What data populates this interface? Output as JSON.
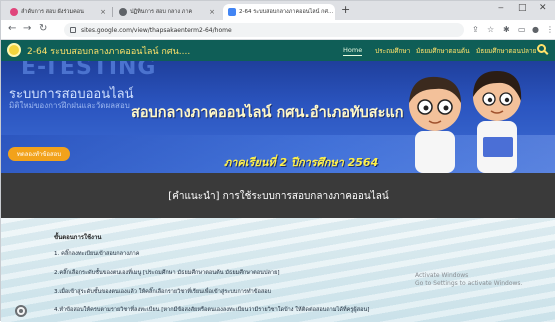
{
  "browser": {
    "tabs": [
      {
        "label": "ลำดับการ สอบ ผังร่วมคอน",
        "color": "#e0457b"
      },
      {
        "label": "ปฏิทินการ สอบ กลาง ภาค",
        "color": "#5f6368"
      },
      {
        "label": "2-64 ระบบสอบกลางภาคออนไลน์ กศ...",
        "color": "#4285f4"
      }
    ],
    "url": "sites.google.com/view/thapsakaenterm2-64/home",
    "window_controls": [
      "‒",
      "□",
      "✕"
    ]
  },
  "site": {
    "title": "2-64 ระบบสอบกลางภาคออนไลน์ กศน....",
    "nav": [
      "Home",
      "ประถมศึกษา",
      "มัธยมศึกษาตอนต้น",
      "มัธยมศึกษาตอนปลาย"
    ],
    "accent": "#0f5e57",
    "nav_color": "#ffe26a"
  },
  "hero": {
    "watermark": "E-TESTING",
    "bg_title": "ระบบการสอบออนไลน์",
    "bg_subtitle": "มิติใหม่ของการฝึกฝนและวัดผลสอบ",
    "line1": "สอบกลางภาคออนไลน์ กศน.อำเภอทับสะแก",
    "line2": "ภาคเรียนที่ 2  ปีการศึกษา 2564",
    "button": "ทดลองทำข้อสอบ"
  },
  "notice": {
    "title": "[คำแนะนำ] การใช้ระบบการสอบกลางภาคออนไลน์"
  },
  "steps": {
    "heading": "ขั้นตอนการใช้งาน",
    "items": [
      "1. คลิ๊กลงทะเบียนเข้าสอบกลางภาค",
      "2.คลิ๊กเลือกระดับชั้นของตนเองที่เมนู [ประถมศึกษา มัธยมศึกษาตอนต้น มัธยมศึกษาตอนปลาย]",
      "3.เมื่อเข้าสู่ระดับชั้นของตนเองแล้ว ให้คลิ๊กเลือกรายวิชาที่เรียนเพื่อเข้าสู่ระบบการทำข้อสอบ",
      "4.ทำข้อสอบให้ครบตามรายวิชาที่ลงทะเบียน [หากมีข้อสงสัยหรือตนเองลงทะเบียนว่ามีรายวิชาใดบ้าง ให้ติดต่อสอบถามได้ที่ครูผู้สอน]"
    ]
  },
  "os_notice": {
    "line1": "Activate Windows",
    "line2": "Go to Settings to activate Windows."
  }
}
